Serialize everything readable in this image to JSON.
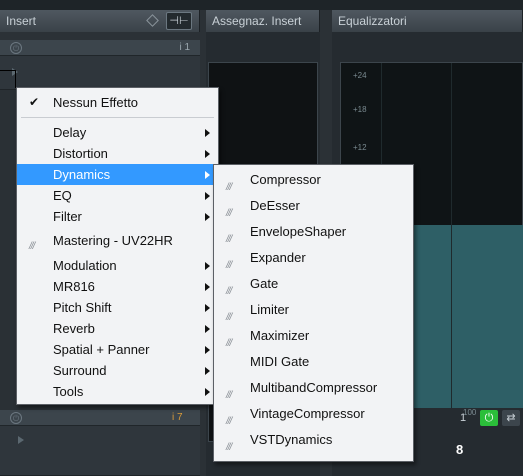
{
  "panels": {
    "insert_title": "Insert",
    "assign_title": "Assegnaz. Insert",
    "eq_title": "Equalizzatori"
  },
  "slots": {
    "top_slot_number": "i 1",
    "bottom_slot_number": "i 7",
    "right_slot_number": "1",
    "right_value": "8"
  },
  "eq": {
    "db_labels": [
      "+24",
      "+18",
      "+12"
    ],
    "freq_label": "100"
  },
  "menu": {
    "items": [
      {
        "label": "Nessun Effetto",
        "checked": true,
        "submenu": false,
        "plugin": false
      },
      {
        "label": "Delay",
        "submenu": true
      },
      {
        "label": "Distortion",
        "submenu": true
      },
      {
        "label": "Dynamics",
        "submenu": true,
        "highlighted": true
      },
      {
        "label": "EQ",
        "submenu": true
      },
      {
        "label": "Filter",
        "submenu": true
      },
      {
        "label": "Mastering - UV22HR",
        "plugin": true
      },
      {
        "label": "Modulation",
        "submenu": true
      },
      {
        "label": "MR816",
        "submenu": true
      },
      {
        "label": "Pitch Shift",
        "submenu": true
      },
      {
        "label": "Reverb",
        "submenu": true
      },
      {
        "label": "Spatial + Panner",
        "submenu": true
      },
      {
        "label": "Surround",
        "submenu": true
      },
      {
        "label": "Tools",
        "submenu": true
      }
    ],
    "checkmark": "✔",
    "plugin_glyph": "///"
  },
  "submenu": {
    "items": [
      {
        "label": "Compressor",
        "plugin": true
      },
      {
        "label": "DeEsser",
        "plugin": true
      },
      {
        "label": "EnvelopeShaper",
        "plugin": true
      },
      {
        "label": "Expander",
        "plugin": true
      },
      {
        "label": "Gate",
        "plugin": true
      },
      {
        "label": "Limiter",
        "plugin": true
      },
      {
        "label": "Maximizer",
        "plugin": true
      },
      {
        "label": "MIDI Gate",
        "plugin": false
      },
      {
        "label": "MultibandCompressor",
        "plugin": true
      },
      {
        "label": "VintageCompressor",
        "plugin": true
      },
      {
        "label": "VSTDynamics",
        "plugin": true
      }
    ]
  },
  "colors": {
    "highlight": "#3399ff",
    "eq_fill": "#2e5f66",
    "power_on": "#2bbf3a"
  }
}
